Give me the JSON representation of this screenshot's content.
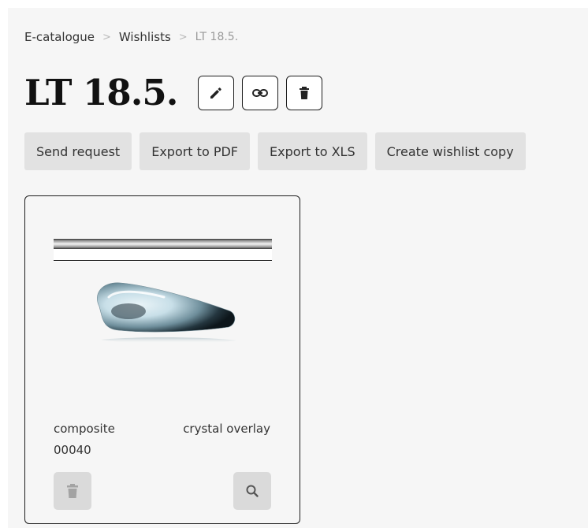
{
  "breadcrumb": {
    "items": [
      "E-catalogue",
      "Wishlists"
    ],
    "current": "LT 18.5.",
    "separator": ">"
  },
  "wishlist": {
    "title": "LT 18.5.",
    "icons": [
      "edit-icon",
      "link-icon",
      "trash-icon"
    ]
  },
  "actions": [
    "Send request",
    "Export to PDF",
    "Export to XLS",
    "Create wishlist copy"
  ],
  "product": {
    "name": "composite",
    "finish": "crystal overlay",
    "code": "00040",
    "icons": [
      "trash-icon",
      "search-icon"
    ]
  }
}
